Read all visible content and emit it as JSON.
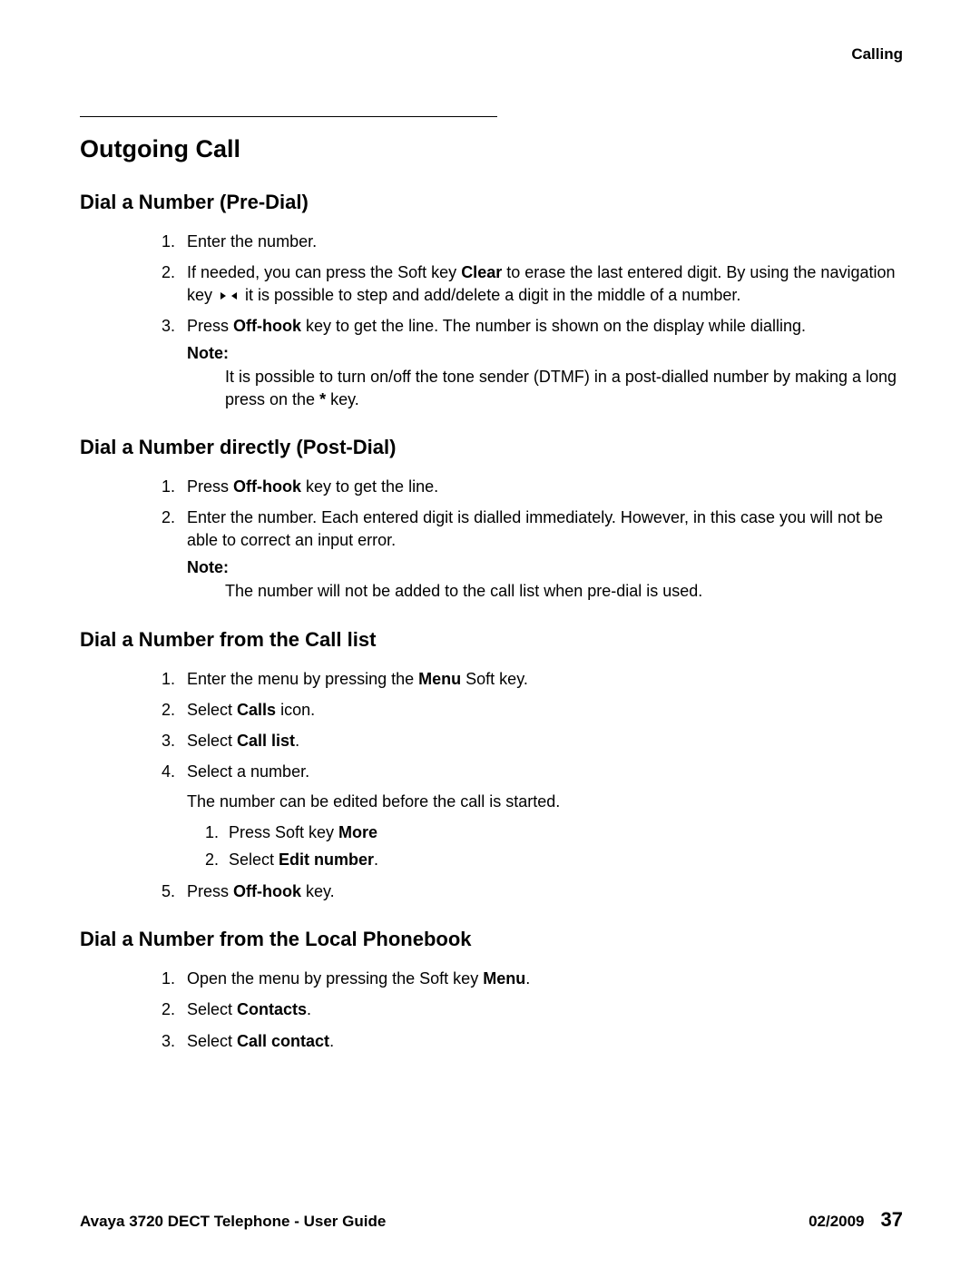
{
  "header": {
    "section_name": "Calling"
  },
  "title": "Outgoing Call",
  "predial": {
    "heading": "Dial a Number (Pre-Dial)",
    "step1": "Enter the number.",
    "step2_a": "If needed, you can press the Soft key ",
    "step2_clear": "Clear",
    "step2_b": " to erase the last entered digit. By using the navigation key ",
    "step2_c": " it is possible to step and add/delete a digit in the middle of a number.",
    "step3_a": "Press ",
    "step3_bold": "Off-hook",
    "step3_b": " key to get the line. The number is shown on the display while dialling.",
    "note_label": "Note:",
    "note_body_a": "It is possible to turn on/off the tone sender (DTMF) in a post-dialled number by making a long press on the ",
    "note_star": "*",
    "note_body_b": " key."
  },
  "postdial": {
    "heading": "Dial a Number directly (Post-Dial)",
    "step1_a": "Press ",
    "step1_bold": "Off-hook",
    "step1_b": " key to get the line.",
    "step2": "Enter the number. Each entered digit is dialled immediately. However, in this case you will not be able to correct an input error.",
    "note_label": "Note:",
    "note_body": "The number will not be added to the call list when pre-dial is used."
  },
  "calllist": {
    "heading": "Dial a Number from the Call list",
    "step1_a": "Enter the menu by pressing the ",
    "step1_bold": "Menu",
    "step1_b": " Soft key.",
    "step2_a": "Select ",
    "step2_bold": "Calls",
    "step2_b": " icon.",
    "step3_a": "Select ",
    "step3_bold": "Call list",
    "step3_b": ".",
    "step4": "Select a number.",
    "step4_para": "The number can be edited before the call is started.",
    "sub1_a": "Press Soft key ",
    "sub1_bold": "More",
    "sub2_a": "Select ",
    "sub2_bold": "Edit number",
    "sub2_b": ".",
    "step5_a": "Press ",
    "step5_bold": "Off-hook",
    "step5_b": " key."
  },
  "phonebook": {
    "heading": "Dial a Number from the Local Phonebook",
    "step1_a": "Open the menu by pressing the Soft key ",
    "step1_bold": "Menu",
    "step1_b": ".",
    "step2_a": "Select ",
    "step2_bold": "Contacts",
    "step2_b": ".",
    "step3_a": "Select ",
    "step3_bold": "Call contact",
    "step3_b": "."
  },
  "footer": {
    "doc_title": "Avaya 3720 DECT Telephone - User Guide",
    "date": "02/2009",
    "page": "37"
  }
}
